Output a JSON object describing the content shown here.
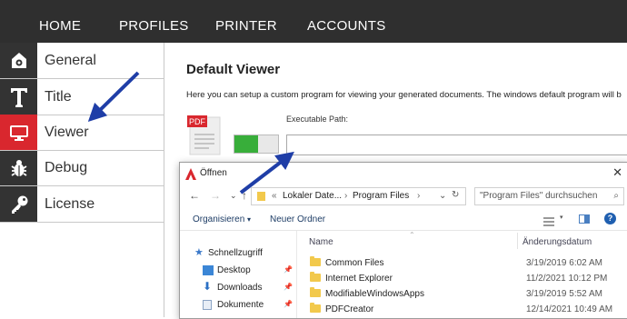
{
  "nav": {
    "home": "HOME",
    "profiles": "PROFILES",
    "printer": "PRINTER",
    "accounts": "ACCOUNTS"
  },
  "sidebar": {
    "items": [
      {
        "label": "General",
        "icon": "gear-icon"
      },
      {
        "label": "Title",
        "icon": "title-t-icon"
      },
      {
        "label": "Viewer",
        "icon": "monitor-icon",
        "active": true
      },
      {
        "label": "Debug",
        "icon": "bug-icon"
      },
      {
        "label": "License",
        "icon": "key-icon"
      }
    ]
  },
  "main": {
    "title": "Default Viewer",
    "description": "Here you can setup a custom program for viewing your generated documents. The windows default program will b",
    "pdf_badge": "PDF",
    "path_label": "Executable Path:",
    "path_value": ""
  },
  "dialog": {
    "title": "Öffnen",
    "close": "✕",
    "address": {
      "ellipsis": "«",
      "lokaler": "Lokaler Date...",
      "sep1": "›",
      "program_files": "Program Files",
      "sep2": "›"
    },
    "search_placeholder": "\"Program Files\" durchsuchen",
    "organize": "Organisieren",
    "organize_caret": "▾",
    "new_folder": "Neuer Ordner",
    "nav_pane": [
      {
        "label": "Schnellzugriff",
        "icon": "star-icon"
      },
      {
        "label": "Desktop",
        "icon": "desktop-icon"
      },
      {
        "label": "Downloads",
        "icon": "download-icon"
      },
      {
        "label": "Dokumente",
        "icon": "document-icon"
      }
    ],
    "columns": {
      "name": "Name",
      "date": "Änderungsdatum"
    },
    "files": [
      {
        "name": "Common Files",
        "date": "3/19/2019 6:02 AM"
      },
      {
        "name": "Internet Explorer",
        "date": "11/2/2021 10:12 PM"
      },
      {
        "name": "ModifiableWindowsApps",
        "date": "3/19/2019 5:52 AM"
      },
      {
        "name": "PDFCreator",
        "date": "12/14/2021 10:49 AM"
      }
    ]
  },
  "colors": {
    "nav_bg": "#2f2f2f",
    "active_red": "#d9272e",
    "toggle_green": "#38ae3a",
    "arrow_blue": "#1f3ea7"
  }
}
